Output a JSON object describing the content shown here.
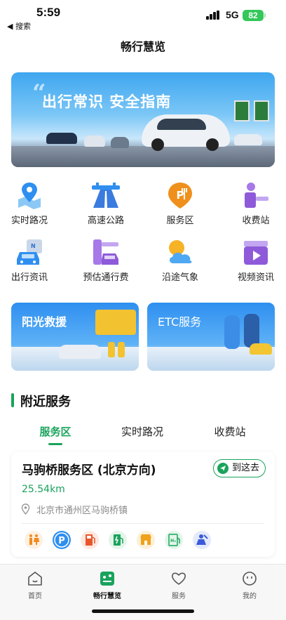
{
  "status": {
    "time": "5:59",
    "back_label": "◀ 搜索",
    "network": "5G",
    "battery": "82"
  },
  "header": {
    "title": "畅行慧览"
  },
  "banner": {
    "title": "出行常识  安全指南"
  },
  "quick_grid": [
    {
      "label": "实时路况",
      "icon": "map-pin-icon"
    },
    {
      "label": "高速公路",
      "icon": "highway-icon"
    },
    {
      "label": "服务区",
      "icon": "service-area-icon"
    },
    {
      "label": "收费站",
      "icon": "toll-booth-icon"
    },
    {
      "label": "出行资讯",
      "icon": "news-car-icon"
    },
    {
      "label": "预估通行费",
      "icon": "toll-estimate-icon"
    },
    {
      "label": "沿途气象",
      "icon": "weather-icon"
    },
    {
      "label": "视频资讯",
      "icon": "video-icon"
    }
  ],
  "promos": [
    {
      "title": "阳光救援"
    },
    {
      "title": "ETC服务"
    }
  ],
  "nearby": {
    "title": "附近服务",
    "tabs": [
      "服务区",
      "实时路况",
      "收费站"
    ],
    "active_tab": 0
  },
  "station": {
    "name": "马驹桥服务区 (北京方向)",
    "go_label": "到这去",
    "distance": "25.54km",
    "address": "北京市通州区马驹桥镇",
    "facilities": [
      {
        "icon": "restroom-icon",
        "color": "#f08a1c"
      },
      {
        "icon": "parking-icon",
        "color": "#2f8ff0"
      },
      {
        "icon": "fuel-icon",
        "color": "#e8562a"
      },
      {
        "icon": "ev-charging-icon",
        "color": "#1aa35c"
      },
      {
        "icon": "shop-icon",
        "color": "#f0a21c"
      },
      {
        "icon": "hydrogen-icon",
        "color": "#1aa35c"
      },
      {
        "icon": "repair-icon",
        "color": "#3a5bd9"
      }
    ]
  },
  "tabbar": [
    {
      "label": "首页",
      "icon": "home-icon"
    },
    {
      "label": "畅行慧览",
      "icon": "smart-travel-icon",
      "active": true
    },
    {
      "label": "服务",
      "icon": "heart-icon"
    },
    {
      "label": "我的",
      "icon": "profile-icon"
    }
  ],
  "colors": {
    "accent": "#1aa35c",
    "blue": "#2f8ff0"
  }
}
